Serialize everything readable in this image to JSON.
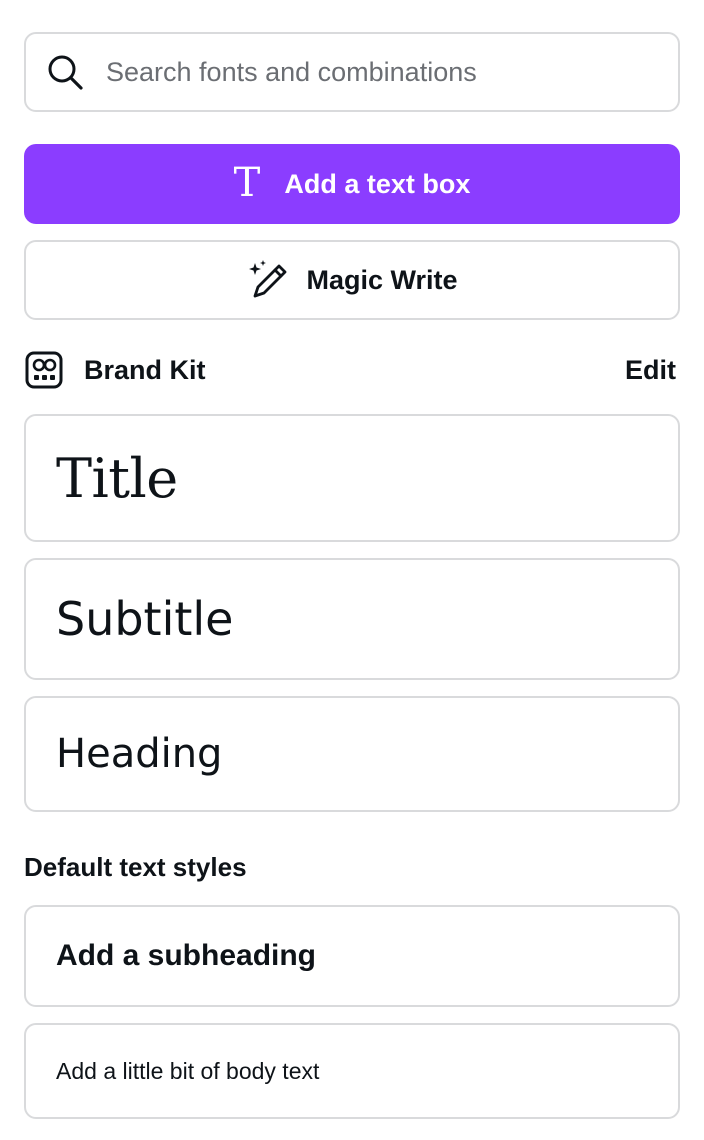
{
  "search": {
    "placeholder": "Search fonts and combinations",
    "icon": "search-icon"
  },
  "add_text_box": {
    "label": "Add a text box",
    "icon": "text-t-icon",
    "glyph": "T",
    "color": "#8b3dff"
  },
  "magic_write": {
    "label": "Magic Write",
    "icon": "magic-pencil-icon"
  },
  "brand_kit": {
    "label": "Brand Kit",
    "icon": "brand-kit-icon",
    "edit_label": "Edit"
  },
  "brand_styles": {
    "title": "Title",
    "subtitle": "Subtitle",
    "heading": "Heading"
  },
  "default_styles": {
    "section_label": "Default text styles",
    "subheading": "Add a subheading",
    "body": "Add a little bit of body text"
  }
}
